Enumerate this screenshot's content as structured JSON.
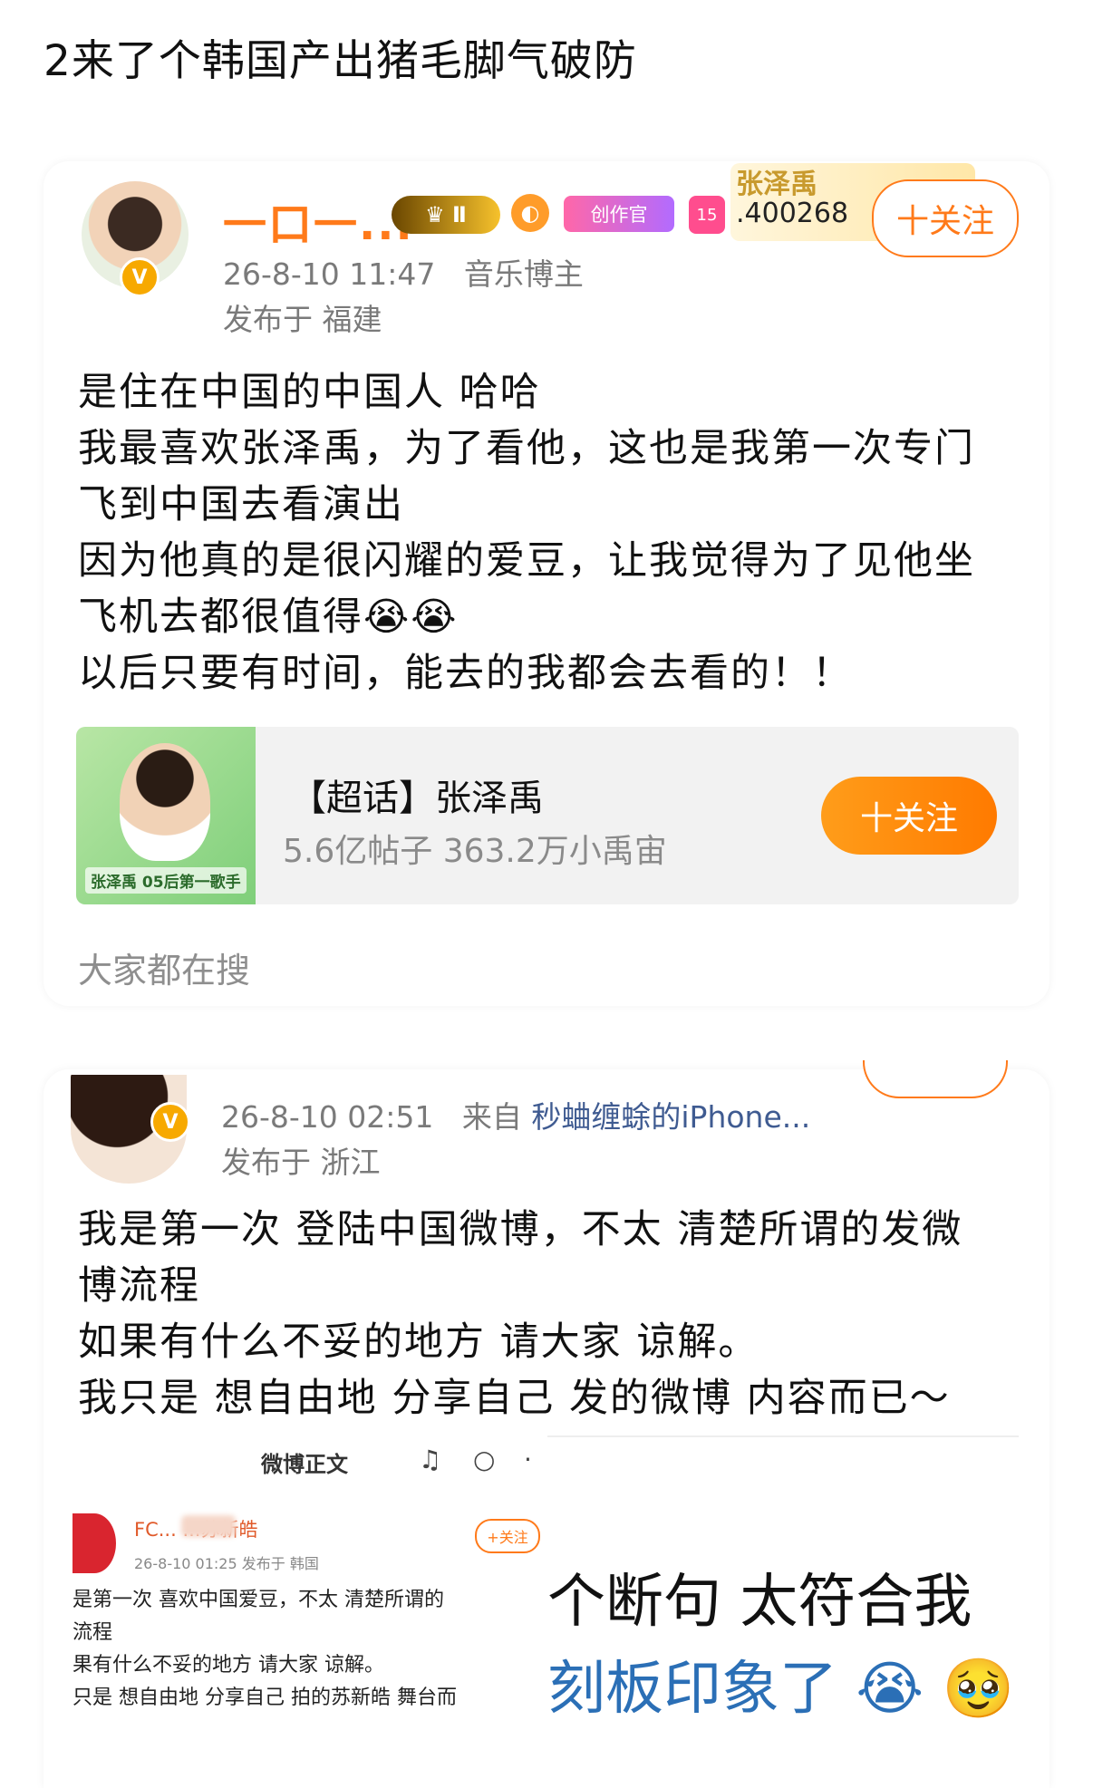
{
  "page_title": "2来了个韩国产出猪毛脚气破防",
  "post1": {
    "username": "一口一...",
    "badge_crown": "Ⅱ",
    "badge_creator": "创作官",
    "badge_gem": "15",
    "fan_name": "张泽禹",
    "fan_number": ".400268",
    "follow": "十关注",
    "time": "26-8-10 11:47",
    "role": "音乐博主",
    "location": "发布于 福建",
    "lines": [
      "是住在中国的中国人 哈哈",
      "我最喜欢张泽禹，为了看他，这也是我第一次专门",
      "飞到中国去看演出",
      "因为他真的是很闪耀的爱豆，让我觉得为了见他坐",
      "飞机去都很值得😭😭",
      "以后只要有时间，能去的我都会去看的！！"
    ],
    "topic": {
      "title": "【超话】张泽禹",
      "stats": "5.6亿帖子 363.2万小禹宙",
      "follow": "十关注",
      "image_tag": "05后第一歌手",
      "image_name": "张泽禹"
    },
    "search_hint": "大家都在搜"
  },
  "post2": {
    "time": "26-8-10 02:51",
    "source_prefix": "来自",
    "device": "秒蛐缠蜍的iPhone...",
    "location": "发布于 浙江",
    "lines": [
      "我是第一次 登陆中国微博，不太 清楚所谓的发微",
      "博流程",
      "如果有什么不妥的地方 请大家 谅解。",
      "我只是 想自由地 分享自己 发的微博 内容而已～"
    ]
  },
  "embedded": {
    "header": "微博正文",
    "name": "FC... ...苏新皓",
    "follow": "+关注",
    "meta": "26-8-10 01:25  发布于 韩国",
    "lines": [
      "是第一次 喜欢中国爱豆，不太 清楚所谓的",
      "流程",
      "果有什么不妥的地方 请大家 谅解。",
      "只是 想自由地 分享自己 拍的苏新皓 舞台而"
    ]
  },
  "caption": {
    "line1": "个断句 太符合我",
    "line2": "刻板印象了 😭 🥹"
  },
  "colors": {
    "accent_orange": "#ff7a1a",
    "meta_gray": "#7a7a7a",
    "device_blue": "#3f5b91",
    "caption_blue": "#2b6fb6"
  }
}
